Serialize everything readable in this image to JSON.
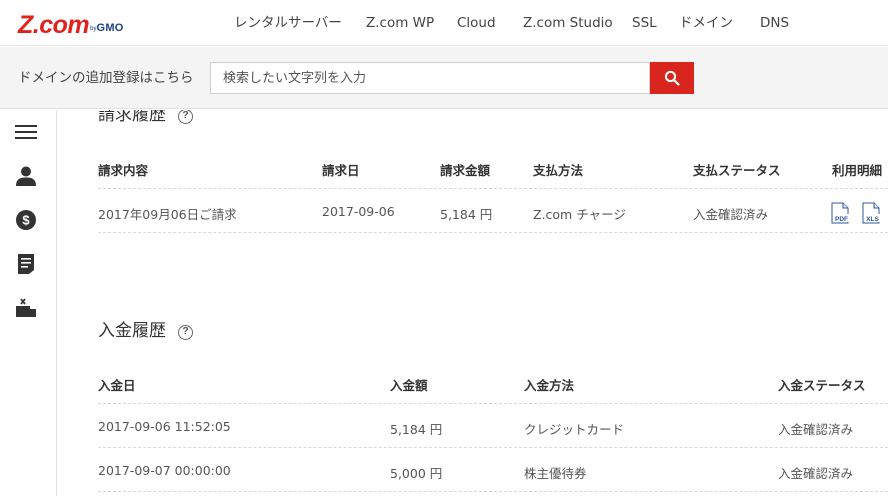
{
  "header": {
    "logo": {
      "main": "Z.com",
      "by": "by",
      "gmo": "GMO"
    },
    "nav": [
      "レンタルサーバー",
      "Z.com WP",
      "Cloud",
      "Z.com Studio",
      "SSL",
      "ドメイン",
      "DNS"
    ]
  },
  "search": {
    "label": "ドメインの追加登録はこちら",
    "placeholder": "検索したい文字列を入力",
    "button_icon": "search-icon"
  },
  "sidebar": {
    "items": [
      "menu-icon",
      "user-icon",
      "dollar-icon",
      "document-icon",
      "tools-icon"
    ]
  },
  "billing": {
    "title": "請求履歴",
    "help": "?",
    "headers": [
      "請求内容",
      "請求日",
      "請求金額",
      "支払方法",
      "支払ステータス",
      "利用明細"
    ],
    "rows": [
      {
        "content": "2017年09月06日ご請求",
        "date": "2017-09-06",
        "amount": "5,184 円",
        "method": "Z.com チャージ",
        "status": "入金確認済み",
        "pdf": "PDF",
        "xls": "XLS"
      }
    ]
  },
  "payments": {
    "title": "入金履歴",
    "help": "?",
    "headers": [
      "入金日",
      "入金額",
      "入金方法",
      "入金ステータス"
    ],
    "rows": [
      {
        "date": "2017-09-06 11:52:05",
        "amount": "5,184 円",
        "method": "クレジットカード",
        "status": "入金確認済み"
      },
      {
        "date": "2017-09-07 00:00:00",
        "amount": "5,000 円",
        "method": "株主優待券",
        "status": "入金確認済み"
      }
    ]
  },
  "colors": {
    "brand_red": "#e1231f",
    "search_button": "#d8261f",
    "gmo_blue": "#1f3f8a",
    "doc_icon_blue": "#2b5a9e"
  }
}
